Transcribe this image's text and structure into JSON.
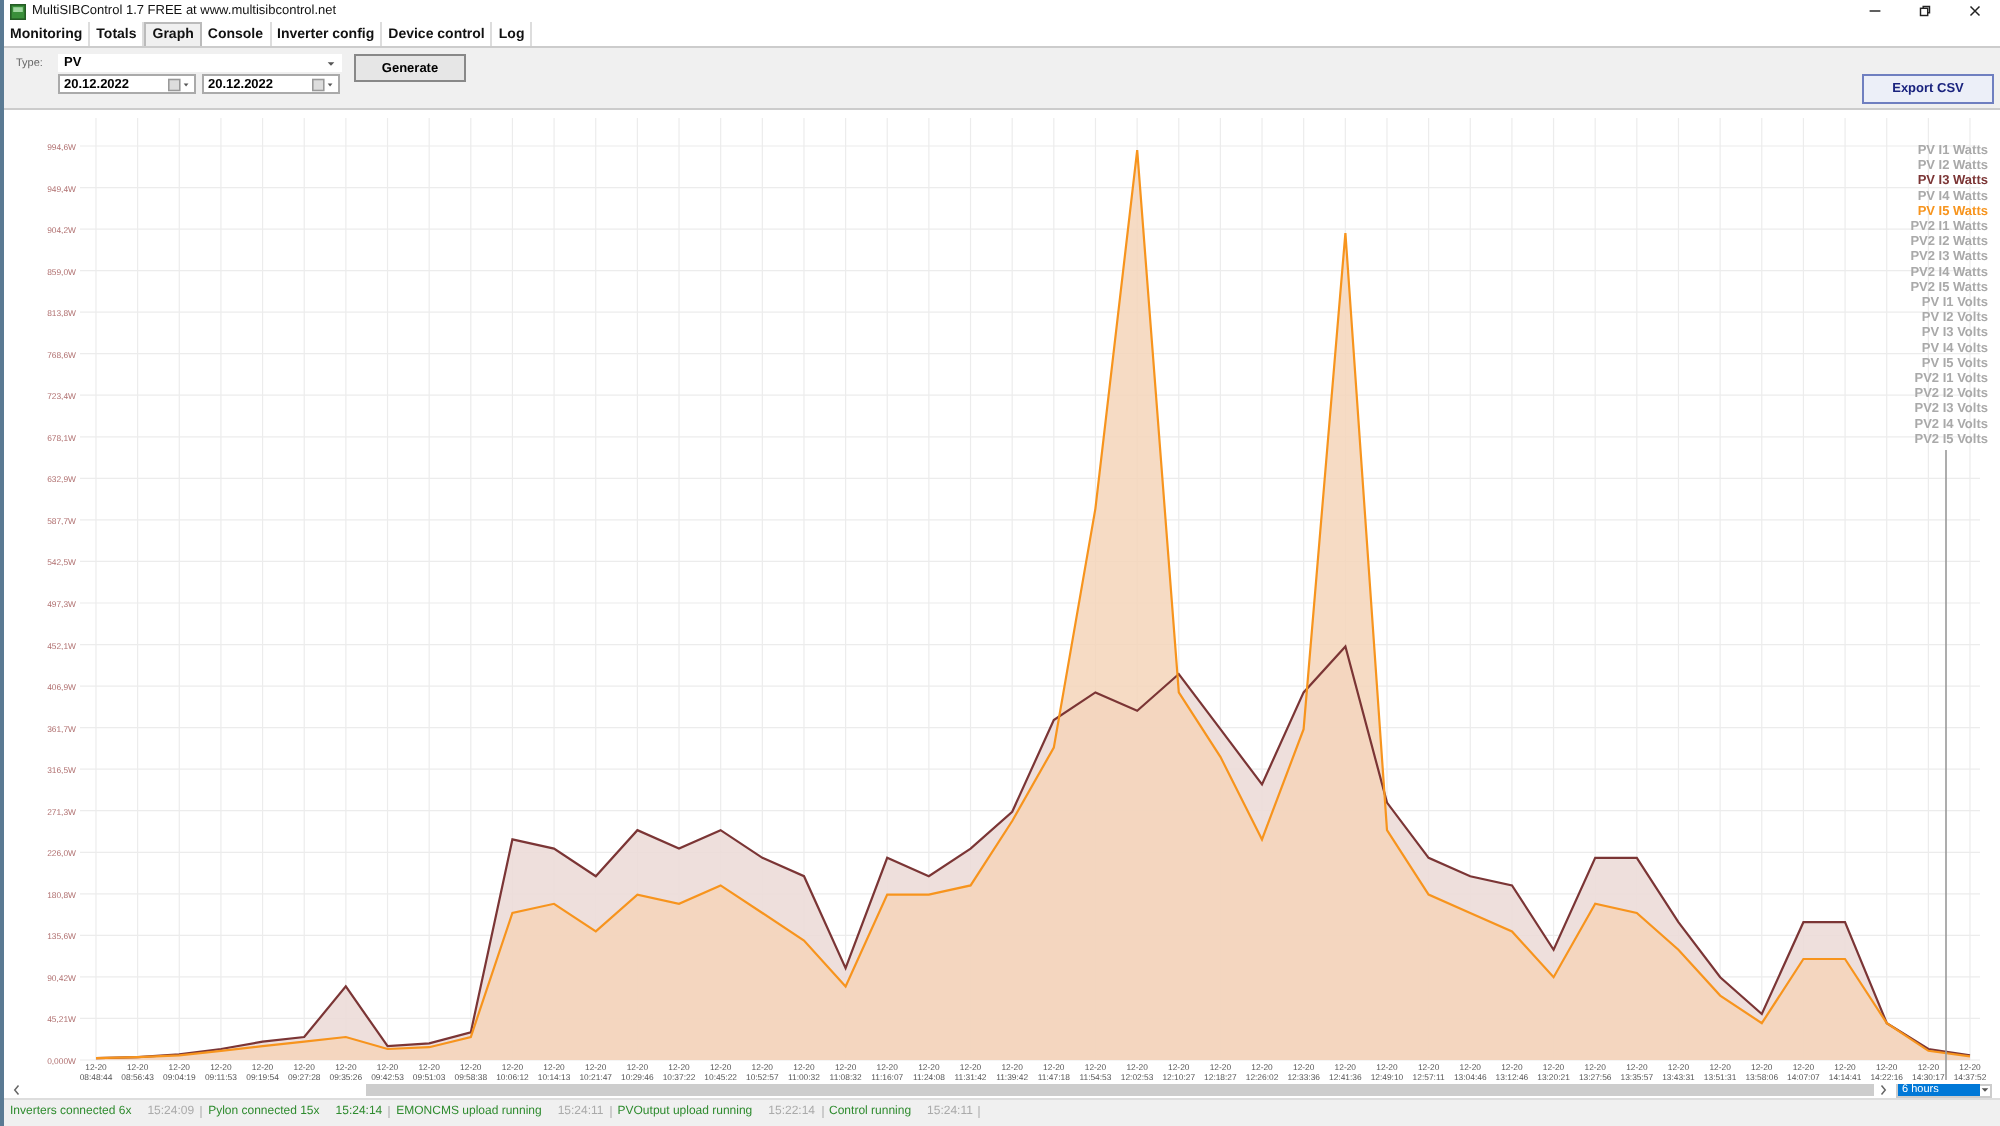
{
  "window": {
    "title": "MultiSIBControl 1.7 FREE at www.multisibcontrol.net"
  },
  "tabs": [
    {
      "label": "Monitoring",
      "selected": false
    },
    {
      "label": "Totals",
      "selected": false
    },
    {
      "label": "Graph",
      "selected": true
    },
    {
      "label": "Console",
      "selected": false
    },
    {
      "label": "Inverter config",
      "selected": false
    },
    {
      "label": "Device control",
      "selected": false
    },
    {
      "label": "Log",
      "selected": false
    }
  ],
  "controls": {
    "type_label": "Type:",
    "type_value": "PV",
    "date_from": "20.12.2022",
    "date_to": "20.12.2022",
    "generate_button": "Generate",
    "export_button": "Export CSV"
  },
  "chart": {
    "legend": [
      {
        "label": "PV I1 Watts",
        "selected": false
      },
      {
        "label": "PV I2 Watts",
        "selected": false
      },
      {
        "label": "PV I3 Watts",
        "selected": true
      },
      {
        "label": "PV I4 Watts",
        "selected": false
      },
      {
        "label": "PV I5 Watts",
        "selected": true
      },
      {
        "label": "PV2 I1 Watts",
        "selected": false
      },
      {
        "label": "PV2 I2 Watts",
        "selected": false
      },
      {
        "label": "PV2 I3 Watts",
        "selected": false
      },
      {
        "label": "PV2 I4 Watts",
        "selected": false
      },
      {
        "label": "PV2 I5 Watts",
        "selected": false
      },
      {
        "label": "PV I1 Volts",
        "selected": false
      },
      {
        "label": "PV I2 Volts",
        "selected": false
      },
      {
        "label": "PV I3 Volts",
        "selected": false
      },
      {
        "label": "PV I4 Volts",
        "selected": false
      },
      {
        "label": "PV I5 Volts",
        "selected": false
      },
      {
        "label": "PV2 I1 Volts",
        "selected": false
      },
      {
        "label": "PV2 I2 Volts",
        "selected": false
      },
      {
        "label": "PV2 I3 Volts",
        "selected": false
      },
      {
        "label": "PV2 I4 Volts",
        "selected": false
      },
      {
        "label": "PV2 I5 Volts",
        "selected": false
      }
    ],
    "chart_data": {
      "type": "area",
      "grid": true,
      "categories": [
        "12-20 08:48:44",
        "12-20 08:56:43",
        "12-20 09:04:19",
        "12-20 09:11:53",
        "12-20 09:19:54",
        "12-20 09:27:28",
        "12-20 09:35:26",
        "12-20 09:42:53",
        "12-20 09:51:03",
        "12-20 09:58:38",
        "12-20 10:06:12",
        "12-20 10:14:13",
        "12-20 10:21:47",
        "12-20 10:29:46",
        "12-20 10:37:22",
        "12-20 10:45:22",
        "12-20 10:52:57",
        "12-20 11:00:32",
        "12-20 11:08:32",
        "12-20 11:16:07",
        "12-20 11:24:08",
        "12-20 11:31:42",
        "12-20 11:39:42",
        "12-20 11:47:18",
        "12-20 11:54:53",
        "12-20 12:02:53",
        "12-20 12:10:27",
        "12-20 12:18:27",
        "12-20 12:26:02",
        "12-20 12:33:36",
        "12-20 12:41:36",
        "12-20 12:49:10",
        "12-20 12:57:11",
        "12-20 13:04:46",
        "12-20 13:12:46",
        "12-20 13:20:21",
        "12-20 13:27:56",
        "12-20 13:35:57",
        "12-20 13:43:31",
        "12-20 13:51:31",
        "12-20 13:58:06",
        "12-20 14:07:07",
        "12-20 14:14:41",
        "12-20 14:22:16",
        "12-20 14:30:17",
        "12-20 14:37:52"
      ],
      "series": [
        {
          "color": "#7b3535",
          "values": [
            2,
            3,
            6,
            12,
            20,
            25,
            80,
            15,
            18,
            30,
            240,
            230,
            200,
            250,
            230,
            250,
            220,
            200,
            100,
            220,
            200,
            230,
            270,
            370,
            400,
            380,
            420,
            360,
            300,
            400,
            450,
            280,
            220,
            200,
            190,
            120,
            220,
            220,
            150,
            90,
            50,
            150,
            150,
            40,
            12,
            5
          ]
        },
        {
          "color": "#f7941d",
          "values": [
            2,
            3,
            5,
            10,
            15,
            20,
            25,
            12,
            14,
            25,
            160,
            170,
            140,
            180,
            170,
            190,
            160,
            130,
            80,
            180,
            180,
            190,
            260,
            340,
            600,
            990,
            400,
            330,
            240,
            360,
            900,
            250,
            180,
            160,
            140,
            90,
            170,
            160,
            120,
            70,
            40,
            110,
            110,
            40,
            10,
            4
          ]
        }
      ],
      "ylim": [
        0,
        994.6
      ],
      "yticks": [
        {
          "value": 0,
          "label": "0,000W"
        },
        {
          "value": 45.21,
          "label": "45,21W"
        },
        {
          "value": 90.42,
          "label": "90,42W"
        },
        {
          "value": 135.6,
          "label": "135,6W"
        },
        {
          "value": 180.8,
          "label": "180,8W"
        },
        {
          "value": 226.0,
          "label": "226,0W"
        },
        {
          "value": 271.3,
          "label": "271,3W"
        },
        {
          "value": 316.5,
          "label": "316,5W"
        },
        {
          "value": 361.7,
          "label": "361,7W"
        },
        {
          "value": 406.9,
          "label": "406,9W"
        },
        {
          "value": 452.1,
          "label": "452,1W"
        },
        {
          "value": 497.3,
          "label": "497,3W"
        },
        {
          "value": 542.5,
          "label": "542,5W"
        },
        {
          "value": 587.7,
          "label": "587,7W"
        },
        {
          "value": 632.9,
          "label": "632,9W"
        },
        {
          "value": 678.1,
          "label": "678,1W"
        },
        {
          "value": 723.4,
          "label": "723,4W"
        },
        {
          "value": 768.6,
          "label": "768,6W"
        },
        {
          "value": 813.8,
          "label": "813,8W"
        },
        {
          "value": 859.0,
          "label": "859,0W"
        },
        {
          "value": 904.2,
          "label": "904,2W"
        },
        {
          "value": 949.4,
          "label": "949,4W"
        },
        {
          "value": 994.6,
          "label": "994,6W"
        }
      ]
    },
    "range_value": "6 hours"
  },
  "status_bar": [
    {
      "text": "Inverters connected 6x",
      "time": "15:24:09",
      "fresh": false
    },
    {
      "text": "Pylon connected 15x",
      "time": "15:24:14",
      "fresh": true
    },
    {
      "text": "EMONCMS upload running",
      "time": "15:24:11",
      "fresh": false
    },
    {
      "text": "PVOutput upload running",
      "time": "15:22:14",
      "fresh": false
    },
    {
      "text": "Control running",
      "time": "15:24:11",
      "fresh": false
    }
  ]
}
